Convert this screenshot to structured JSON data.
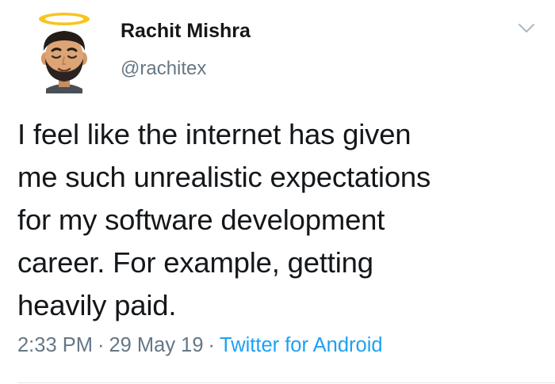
{
  "user": {
    "display_name": "Rachit Mishra",
    "handle": "@rachitex",
    "avatar_icon": "bitmoji-avatar-halo-icon"
  },
  "menu": {
    "caret_icon": "chevron-down-icon"
  },
  "tweet": {
    "text_lines": [
      "I feel like the internet has given",
      "me such unrealistic expectations",
      "for my software development",
      "career. For example, getting",
      "heavily paid."
    ]
  },
  "meta": {
    "time": "2:33 PM",
    "separator": "·",
    "date": "29 May 19",
    "source": "Twitter for Android"
  },
  "colors": {
    "text": "#14171a",
    "secondary": "#657786",
    "link": "#1da1f2",
    "divider": "#e1e8ed"
  }
}
